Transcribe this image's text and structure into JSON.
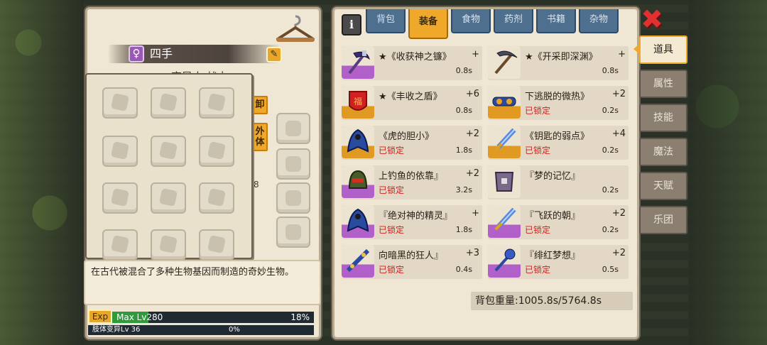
{
  "left_panel": {
    "character_name": "四手",
    "character_class": "变异人 战士",
    "gender_symbol": "♀",
    "side_buttons": {
      "unequip": "卸",
      "external": "外体"
    },
    "level_fragment": "8",
    "description": "在古代被混合了多种生物基因而制造的奇妙生物。",
    "exp": {
      "badge": "Exp",
      "level_text": "Max Lv280",
      "percent_text": "18%",
      "fill_fraction": 0.18,
      "sub_label": "肢体变异Lv 36",
      "sub_percent": "0%"
    }
  },
  "right_panel": {
    "info_label": "i",
    "tabs": [
      {
        "label": "背包",
        "active": false
      },
      {
        "label": "装备",
        "active": true
      },
      {
        "label": "食物",
        "active": false
      },
      {
        "label": "药剂",
        "active": false
      },
      {
        "label": "书籍",
        "active": false
      },
      {
        "label": "杂物",
        "active": false
      }
    ],
    "items": [
      {
        "name": "★《收获神之镰》",
        "plus": "+",
        "locked": "",
        "weight": "0.8s",
        "icon": "scythe-icon",
        "rarity": "purple"
      },
      {
        "name": "★《开采即深渊》",
        "plus": "+",
        "locked": "",
        "weight": "0.8s",
        "icon": "pickaxe-icon",
        "rarity": "none"
      },
      {
        "name": "★《丰收之盾》",
        "plus": "+6",
        "locked": "",
        "weight": "0.8s",
        "icon": "fortune-shield-icon",
        "rarity": "orange"
      },
      {
        "name": "下逃脱的微热》",
        "plus": "+2",
        "locked": "已锁定",
        "weight": "0.2s",
        "icon": "goggles-icon",
        "rarity": "orange"
      },
      {
        "name": "《虎的胆小》",
        "plus": "+2",
        "locked": "已锁定",
        "weight": "1.8s",
        "icon": "cloak-icon",
        "rarity": "orange"
      },
      {
        "name": "《钥匙的弱点》",
        "plus": "+4",
        "locked": "已锁定",
        "weight": "0.2s",
        "icon": "sword-icon",
        "rarity": "orange"
      },
      {
        "name": "上钓鱼的依靠』",
        "plus": "+2",
        "locked": "已锁定",
        "weight": "3.2s",
        "icon": "helmet-icon",
        "rarity": "purple"
      },
      {
        "name": "『梦的记忆』",
        "plus": "",
        "locked": "",
        "weight": "0.2s",
        "icon": "armor-icon",
        "rarity": "none"
      },
      {
        "name": "『绝对神的精灵』",
        "plus": "+",
        "locked": "已锁定",
        "weight": "1.8s",
        "icon": "cloak-icon",
        "rarity": "purple"
      },
      {
        "name": "『飞跃的朝』",
        "plus": "+2",
        "locked": "已锁定",
        "weight": "0.2s",
        "icon": "sword-icon",
        "rarity": "purple"
      },
      {
        "name": "向暗黑的狂人』",
        "plus": "+3",
        "locked": "已锁定",
        "weight": "0.4s",
        "icon": "staff-icon",
        "rarity": "purple"
      },
      {
        "name": "『绯红梦想』",
        "plus": "+2",
        "locked": "已锁定",
        "weight": "0.5s",
        "icon": "mace-icon",
        "rarity": "purple"
      }
    ],
    "bag_weight": "背包重量:1005.8s/5764.8s"
  },
  "category_tabs": [
    {
      "label": "道具",
      "active": true
    },
    {
      "label": "属性",
      "active": false
    },
    {
      "label": "技能",
      "active": false
    },
    {
      "label": "魔法",
      "active": false
    },
    {
      "label": "天赋",
      "active": false
    },
    {
      "label": "乐团",
      "active": false
    }
  ],
  "close_glyph": "✖",
  "colors": {
    "accent": "#f0a82a",
    "panel_bg": "#efe6d3",
    "tab_blue": "#4f6f8f",
    "locked_red": "#d02020",
    "rarity_purple": "#b060c8",
    "rarity_orange": "#e09a24"
  }
}
